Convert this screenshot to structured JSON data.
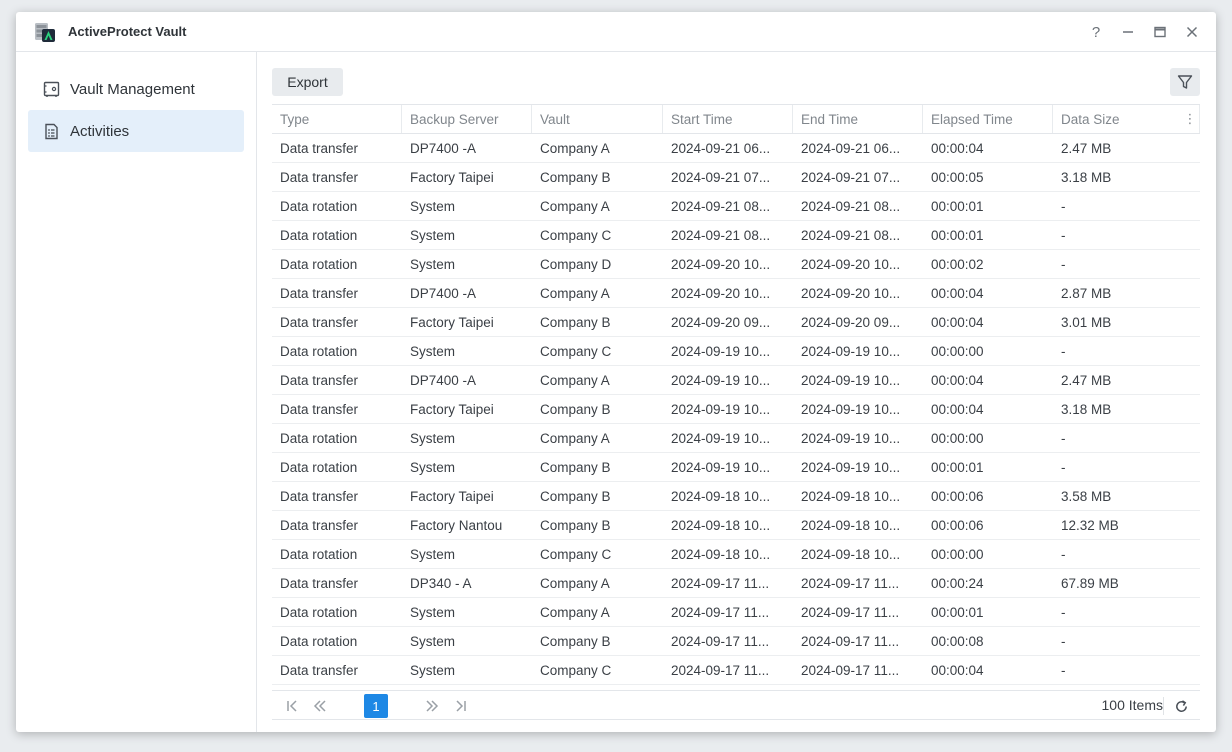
{
  "app": {
    "title": "ActiveProtect Vault"
  },
  "window_controls": {
    "help": "?",
    "minimize": "–",
    "maximize": "▭",
    "close": "✕"
  },
  "sidebar": {
    "items": [
      {
        "label": "Vault Management",
        "icon": "vault-icon",
        "active": false
      },
      {
        "label": "Activities",
        "icon": "log-list-icon",
        "active": true
      }
    ]
  },
  "toolbar": {
    "export_label": "Export",
    "filter_icon": "filter-icon"
  },
  "table": {
    "columns": [
      "Type",
      "Backup Server",
      "Vault",
      "Start Time",
      "End Time",
      "Elapsed Time",
      "Data Size"
    ],
    "rows": [
      [
        "Data transfer",
        "DP7400 -A",
        "Company A",
        "2024-09-21 06...",
        "2024-09-21 06...",
        "00:00:04",
        "2.47 MB"
      ],
      [
        "Data transfer",
        "Factory Taipei",
        "Company B",
        "2024-09-21 07...",
        "2024-09-21 07...",
        "00:00:05",
        "3.18 MB"
      ],
      [
        "Data rotation",
        "System",
        "Company A",
        "2024-09-21 08...",
        "2024-09-21 08...",
        "00:00:01",
        "-"
      ],
      [
        "Data rotation",
        "System",
        "Company C",
        "2024-09-21 08...",
        "2024-09-21 08...",
        "00:00:01",
        "-"
      ],
      [
        "Data rotation",
        "System",
        "Company D",
        "2024-09-20 10...",
        "2024-09-20 10...",
        "00:00:02",
        "-"
      ],
      [
        "Data transfer",
        "DP7400 -A",
        "Company A",
        "2024-09-20 10...",
        "2024-09-20 10...",
        "00:00:04",
        "2.87 MB"
      ],
      [
        "Data transfer",
        "Factory Taipei",
        "Company B",
        "2024-09-20 09...",
        "2024-09-20 09...",
        "00:00:04",
        "3.01 MB"
      ],
      [
        "Data rotation",
        "System",
        "Company C",
        "2024-09-19 10...",
        "2024-09-19 10...",
        "00:00:00",
        "-"
      ],
      [
        "Data transfer",
        "DP7400 -A",
        "Company A",
        "2024-09-19 10...",
        "2024-09-19 10...",
        "00:00:04",
        "2.47 MB"
      ],
      [
        "Data transfer",
        "Factory Taipei",
        "Company B",
        "2024-09-19 10...",
        "2024-09-19 10...",
        "00:00:04",
        "3.18 MB"
      ],
      [
        "Data rotation",
        "System",
        "Company A",
        "2024-09-19 10...",
        "2024-09-19 10...",
        "00:00:00",
        "-"
      ],
      [
        "Data rotation",
        "System",
        "Company B",
        "2024-09-19 10...",
        "2024-09-19 10...",
        "00:00:01",
        "-"
      ],
      [
        "Data transfer",
        "Factory Taipei",
        "Company B",
        "2024-09-18 10...",
        "2024-09-18 10...",
        "00:00:06",
        "3.58 MB"
      ],
      [
        "Data transfer",
        "Factory Nantou",
        "Company B",
        "2024-09-18 10...",
        "2024-09-18 10...",
        "00:00:06",
        "12.32 MB"
      ],
      [
        "Data rotation",
        "System",
        "Company C",
        "2024-09-18 10...",
        "2024-09-18 10...",
        "00:00:00",
        "-"
      ],
      [
        "Data transfer",
        "DP340 - A",
        "Company A",
        "2024-09-17 11...",
        "2024-09-17 11...",
        "00:00:24",
        "67.89 MB"
      ],
      [
        "Data rotation",
        "System",
        "Company A",
        "2024-09-17 11...",
        "2024-09-17 11...",
        "00:00:01",
        "-"
      ],
      [
        "Data rotation",
        "System",
        "Company B",
        "2024-09-17 11...",
        "2024-09-17 11...",
        "00:00:08",
        "-"
      ],
      [
        "Data transfer",
        "System",
        "Company C",
        "2024-09-17 11...",
        "2024-09-17 11...",
        "00:00:04",
        "-"
      ]
    ]
  },
  "pagination": {
    "current_page": "1",
    "items_label": "100 Items"
  },
  "colors": {
    "accent": "#1e88e5",
    "active_nav_bg": "#e4effa"
  }
}
